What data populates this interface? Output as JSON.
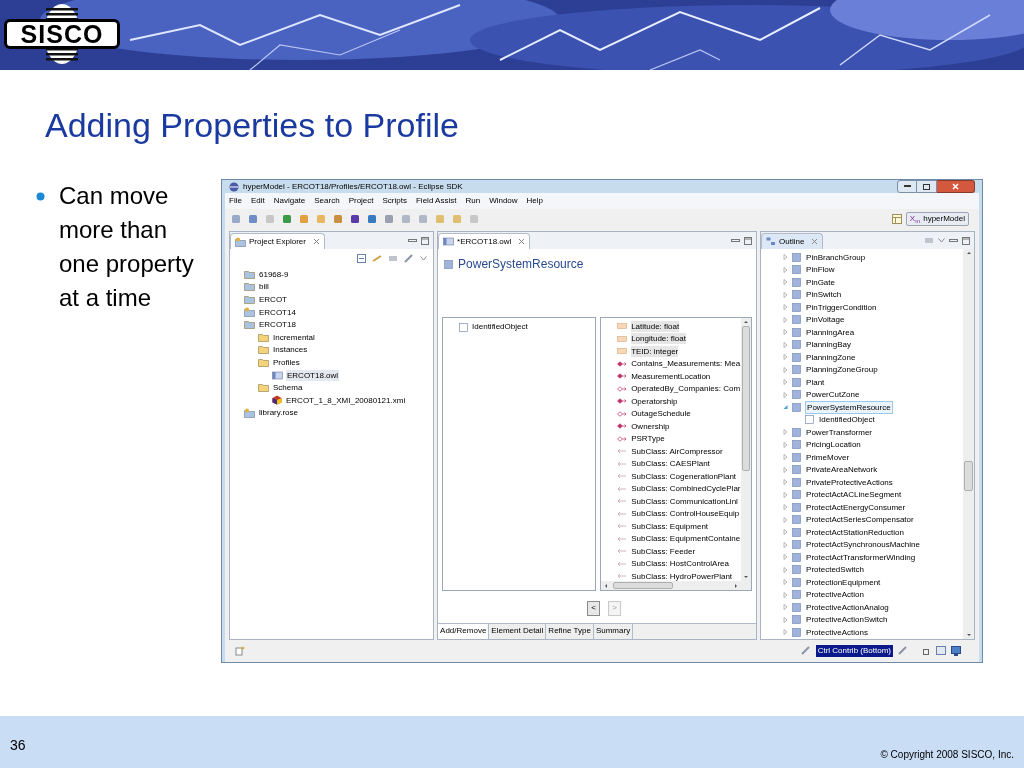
{
  "header": {
    "logo": "SISCO"
  },
  "title": "Adding Properties to Profile",
  "bullets": [
    "Can move more than one property at a time"
  ],
  "window": {
    "title": "hyperModel - ERCOT18/Profiles/ERCOT18.owl - Eclipse SDK",
    "menu": [
      "File",
      "Edit",
      "Navigate",
      "Search",
      "Project",
      "Scripts",
      "Field Assist",
      "Run",
      "Window",
      "Help"
    ],
    "perspective": {
      "mark": "X$_{m}$",
      "label": "hyperModel"
    },
    "project_explorer": {
      "tab": "Project Explorer",
      "items": [
        {
          "label": "61968-9",
          "kind": "project",
          "selected": false
        },
        {
          "label": "bill",
          "kind": "project",
          "selected": false
        },
        {
          "label": "ERCOT",
          "kind": "project",
          "selected": false
        },
        {
          "label": "ERCOT14",
          "kind": "project-linked",
          "selected": false
        },
        {
          "label": "ERCOT18",
          "kind": "project",
          "selected": false,
          "children": [
            {
              "label": "Incremental",
              "kind": "folder",
              "selected": false
            },
            {
              "label": "Instances",
              "kind": "folder",
              "selected": false
            },
            {
              "label": "Profiles",
              "kind": "folder",
              "selected": false,
              "children": [
                {
                  "label": "ERCOT18.owl",
                  "kind": "owl",
                  "selected": true
                }
              ]
            },
            {
              "label": "Schema",
              "kind": "folder",
              "selected": false,
              "children": [
                {
                  "label": "ERCOT_1_8_XMI_20080121.xmi",
                  "kind": "xmi",
                  "selected": false
                }
              ]
            }
          ]
        },
        {
          "label": "library.rose",
          "kind": "project-linked",
          "selected": false
        }
      ]
    },
    "editor": {
      "tab": "*ERCOT18.owl",
      "heading": "PowerSystemResource",
      "left_list": [
        "IdentifiedObject"
      ],
      "right_list": [
        {
          "label": "Latitude: float",
          "kind": "attribute",
          "selected": true
        },
        {
          "label": "Longitude: float",
          "kind": "attribute",
          "selected": true
        },
        {
          "label": "TEID: integer",
          "kind": "attribute",
          "selected": true
        },
        {
          "label": "Contains_Measurements: Mea",
          "kind": "association",
          "selected": false
        },
        {
          "label": "MeasurementLocation",
          "kind": "association",
          "selected": false
        },
        {
          "label": "OperatedBy_Companies: Com",
          "kind": "association-hollow",
          "selected": false
        },
        {
          "label": "Operatorship",
          "kind": "association",
          "selected": false
        },
        {
          "label": "OutageSchedule",
          "kind": "association-hollow",
          "selected": false
        },
        {
          "label": "Ownership",
          "kind": "association",
          "selected": false
        },
        {
          "label": "PSRType",
          "kind": "association-hollow",
          "selected": false
        },
        {
          "label": "SubClass: AirCompressor",
          "kind": "subclass",
          "selected": false
        },
        {
          "label": "SubClass: CAESPlant",
          "kind": "subclass",
          "selected": false
        },
        {
          "label": "SubClass: CogenerationPlant",
          "kind": "subclass",
          "selected": false
        },
        {
          "label": "SubClass: CombinedCyclePlar",
          "kind": "subclass",
          "selected": false
        },
        {
          "label": "SubClass: CommunicationLinl",
          "kind": "subclass",
          "selected": false
        },
        {
          "label": "SubClass: ControlHouseEquip",
          "kind": "subclass",
          "selected": false
        },
        {
          "label": "SubClass: Equipment",
          "kind": "subclass",
          "selected": false
        },
        {
          "label": "SubClass: EquipmentContaine",
          "kind": "subclass",
          "selected": false
        },
        {
          "label": "SubClass: Feeder",
          "kind": "subclass",
          "selected": false
        },
        {
          "label": "SubClass: HostControlArea",
          "kind": "subclass",
          "selected": false
        },
        {
          "label": "SubClass: HydroPowerPlant",
          "kind": "subclass",
          "selected": false
        }
      ],
      "buttons": [
        {
          "label": "<",
          "disabled": false
        },
        {
          "label": ">",
          "disabled": true
        }
      ],
      "tabs": [
        {
          "label": "Add/Remove",
          "selected": true
        },
        {
          "label": "Element Detail",
          "selected": false
        },
        {
          "label": "Refine Type",
          "selected": false
        },
        {
          "label": "Summary",
          "selected": false
        }
      ]
    },
    "outline": {
      "tab": "Outline",
      "items": [
        {
          "label": "PinBranchGroup",
          "expanded": false,
          "selected": false
        },
        {
          "label": "PinFlow",
          "expanded": false,
          "selected": false
        },
        {
          "label": "PinGate",
          "expanded": false,
          "selected": false
        },
        {
          "label": "PinSwitch",
          "expanded": false,
          "selected": false
        },
        {
          "label": "PinTriggerCondition",
          "expanded": false,
          "selected": false
        },
        {
          "label": "PinVoltage",
          "expanded": false,
          "selected": false
        },
        {
          "label": "PlanningArea",
          "expanded": false,
          "selected": false
        },
        {
          "label": "PlanningBay",
          "expanded": false,
          "selected": false
        },
        {
          "label": "PlanningZone",
          "expanded": false,
          "selected": false
        },
        {
          "label": "PlanningZoneGroup",
          "expanded": false,
          "selected": false
        },
        {
          "label": "Plant",
          "expanded": false,
          "selected": false
        },
        {
          "label": "PowerCutZone",
          "expanded": false,
          "selected": false
        },
        {
          "label": "PowerSystemResource",
          "expanded": true,
          "selected": true,
          "children": [
            {
              "label": "IdentifiedObject",
              "selected": false
            }
          ]
        },
        {
          "label": "PowerTransformer",
          "expanded": false,
          "selected": false
        },
        {
          "label": "PricingLocation",
          "expanded": false,
          "selected": false
        },
        {
          "label": "PrimeMover",
          "expanded": false,
          "selected": false
        },
        {
          "label": "PrivateAreaNetwork",
          "expanded": false,
          "selected": false
        },
        {
          "label": "PrivateProtectiveActions",
          "expanded": false,
          "selected": false
        },
        {
          "label": "ProtectActACLineSegment",
          "expanded": false,
          "selected": false
        },
        {
          "label": "ProtectActEnergyConsumer",
          "expanded": false,
          "selected": false
        },
        {
          "label": "ProtectActSeriesCompensator",
          "expanded": false,
          "selected": false
        },
        {
          "label": "ProtectActStationReduction",
          "expanded": false,
          "selected": false
        },
        {
          "label": "ProtectActSynchronousMachine",
          "expanded": false,
          "selected": false
        },
        {
          "label": "ProtectActTransformerWinding",
          "expanded": false,
          "selected": false
        },
        {
          "label": "ProtectedSwitch",
          "expanded": false,
          "selected": false
        },
        {
          "label": "ProtectionEquipment",
          "expanded": false,
          "selected": false
        },
        {
          "label": "ProtectiveAction",
          "expanded": false,
          "selected": false
        },
        {
          "label": "ProtectiveActionAnalog",
          "expanded": false,
          "selected": false
        },
        {
          "label": "ProtectiveActionSwitch",
          "expanded": false,
          "selected": false
        },
        {
          "label": "ProtectiveActions",
          "expanded": false,
          "selected": false
        }
      ]
    },
    "status_bar": {
      "highlight": "Ctrl Contrib (Bottom)"
    }
  },
  "footer": {
    "page": "36",
    "copyright": "© Copyright 2008 SISCO, Inc."
  }
}
